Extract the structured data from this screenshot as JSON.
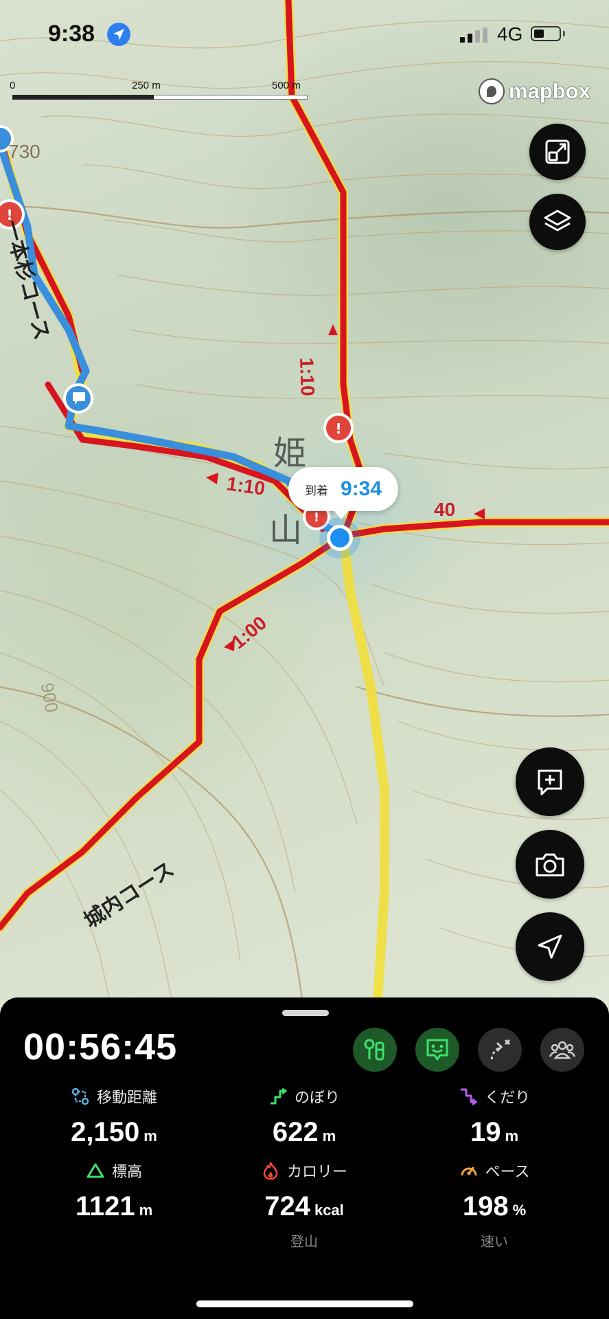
{
  "status_bar": {
    "time": "9:38",
    "network": "4G",
    "location_icon": "location-arrow-icon"
  },
  "map": {
    "scale": {
      "labels": [
        "0",
        "250 m",
        "500 m"
      ]
    },
    "attribution": "mapbox",
    "peak_name": "姫",
    "peak_name_2": "山",
    "courses": [
      "一本杉コース",
      "城内コース"
    ],
    "contour_labels": [
      "730",
      "900"
    ],
    "trail_times": {
      "north": "1:10",
      "west": "1:10",
      "southwest": "1:00",
      "east": "40"
    },
    "arrival": {
      "label": "到着",
      "time": "9:34"
    },
    "colors": {
      "trail_red": "#d6151f",
      "trail_yellow": "#f2df3a",
      "track_blue": "#3a8fdc",
      "current_location": "#1e8ff0"
    }
  },
  "map_controls": {
    "fullscreen_icon": "expand-icon",
    "layers_icon": "layers-icon",
    "memo_icon": "add-note-icon",
    "camera_icon": "camera-icon",
    "navigate_icon": "navigation-arrow-icon"
  },
  "panel": {
    "elapsed_time": "00:56:45",
    "actions": [
      {
        "icon": "trail-mode-icon",
        "active": true
      },
      {
        "icon": "face-notify-icon",
        "active": true
      },
      {
        "icon": "route-off-icon",
        "active": false
      },
      {
        "icon": "group-icon",
        "active": false
      }
    ],
    "stats": [
      {
        "icon": "distance-icon",
        "label": "移動距離",
        "value": "2,150",
        "unit": "m",
        "sub": ""
      },
      {
        "icon": "ascent-icon",
        "label": "のぼり",
        "value": "622",
        "unit": "m",
        "sub": ""
      },
      {
        "icon": "descent-icon",
        "label": "くだり",
        "value": "19",
        "unit": "m",
        "sub": ""
      },
      {
        "icon": "elevation-icon",
        "label": "標高",
        "value": "1121",
        "unit": "m",
        "sub": ""
      },
      {
        "icon": "calorie-icon",
        "label": "カロリー",
        "value": "724",
        "unit": "kcal",
        "sub": "登山"
      },
      {
        "icon": "pace-icon",
        "label": "ペース",
        "value": "198",
        "unit": "%",
        "sub": "速い"
      }
    ]
  }
}
